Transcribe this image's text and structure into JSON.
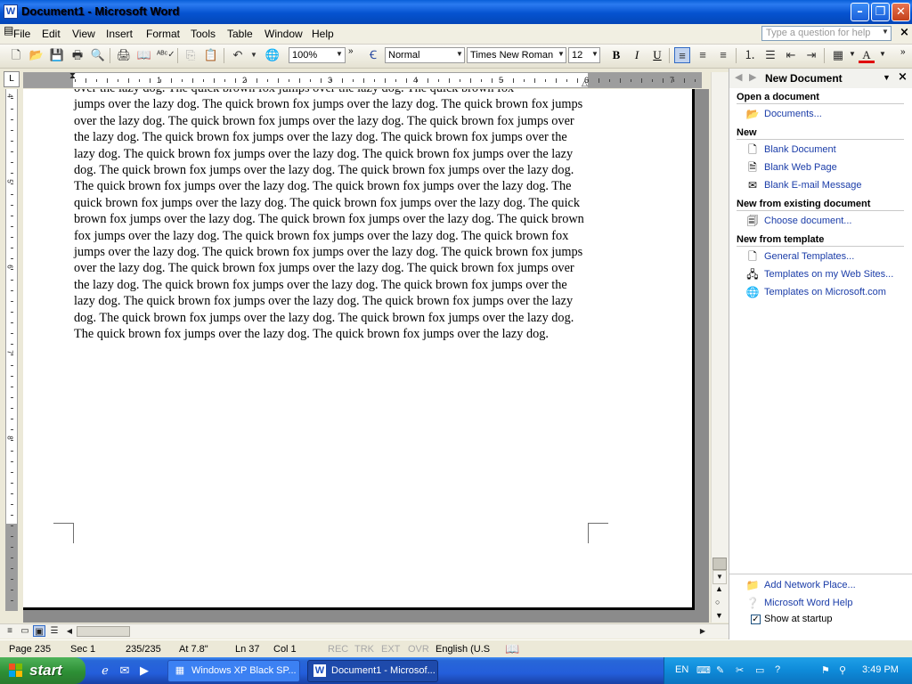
{
  "window": {
    "title": "Document1 - Microsoft Word"
  },
  "menu": {
    "items": [
      "File",
      "Edit",
      "View",
      "Insert",
      "Format",
      "Tools",
      "Table",
      "Window",
      "Help"
    ],
    "help_placeholder": "Type a question for help"
  },
  "toolbar": {
    "zoom": "100%",
    "style": "Normal",
    "font": "Times New Roman",
    "font_size": "12",
    "bold": "B",
    "italic": "I",
    "underline": "U"
  },
  "ruler": {
    "numbers": [
      "1",
      "2",
      "3",
      "4",
      "5",
      "6",
      "7"
    ],
    "vertical_numbers": [
      "4",
      "5",
      "6",
      "7",
      "8"
    ]
  },
  "document": {
    "first_line": "over the lazy dog.  The quick brown fox jumps over the lazy dog.  The quick brown fox",
    "body": "jumps over the lazy dog.  The quick brown fox jumps over the lazy dog.  The quick brown fox jumps over the lazy dog.  The quick brown fox jumps over the lazy dog.  The quick brown fox jumps over the lazy dog.  The quick brown fox jumps over the lazy dog.  The quick brown fox jumps over the lazy dog.  The quick brown fox jumps over the lazy dog.  The quick brown fox jumps over the lazy dog.  The quick brown fox jumps over the lazy dog.  The quick brown fox jumps over the lazy dog.  The quick brown fox jumps over the lazy dog.  The quick brown fox jumps over the lazy dog.  The quick brown fox jumps over the lazy dog.  The quick brown fox jumps over the lazy dog.  The quick brown fox jumps over the lazy dog.  The quick brown fox jumps over the lazy dog.  The quick brown fox jumps over the lazy dog.  The quick brown fox jumps over the lazy dog.  The quick brown fox jumps over the lazy dog.  The quick brown fox jumps over the lazy dog.  The quick brown fox jumps over the lazy dog.  The quick brown fox jumps over the lazy dog.  The quick brown fox jumps over the lazy dog.  The quick brown fox jumps over the lazy dog.  The quick brown fox jumps over the lazy dog.  The quick brown fox jumps over the lazy dog.  The quick brown fox jumps over the lazy dog.  The quick brown fox jumps over the lazy dog.  The quick brown fox jumps over the lazy dog.  The quick brown fox jumps over the lazy dog.  The quick brown fox jumps over the lazy dog."
  },
  "statusbar": {
    "page": "Page 235",
    "sec": "Sec 1",
    "pages": "235/235",
    "at": "At 7.8\"",
    "ln": "Ln 37",
    "col": "Col 1",
    "rec": "REC",
    "trk": "TRK",
    "ext": "EXT",
    "ovr": "OVR",
    "language": "English (U.S"
  },
  "taskpane": {
    "title": "New Document",
    "sections": {
      "open": "Open a document",
      "new": "New",
      "existing": "New from existing document",
      "template": "New from template"
    },
    "links": {
      "documents": "Documents...",
      "blank_document": "Blank Document",
      "blank_web_page": "Blank Web Page",
      "blank_email": "Blank E-mail Message",
      "choose_document": "Choose document...",
      "general_templates": "General Templates...",
      "templates_web_sites": "Templates on my Web Sites...",
      "templates_microsoft": "Templates on Microsoft.com",
      "add_network_place": "Add Network Place...",
      "word_help": "Microsoft Word Help"
    },
    "show_at_startup": "Show at startup"
  },
  "taskbar": {
    "start": "start",
    "tasks": [
      "Windows XP Black SP...",
      "Document1 - Microsof..."
    ],
    "language": "EN",
    "clock": "3:49 PM"
  },
  "colors": {
    "titlebar": "#0553d0",
    "taskbar": "#245edb",
    "start_button": "#2d8f35",
    "link": "#1a3ca8"
  }
}
